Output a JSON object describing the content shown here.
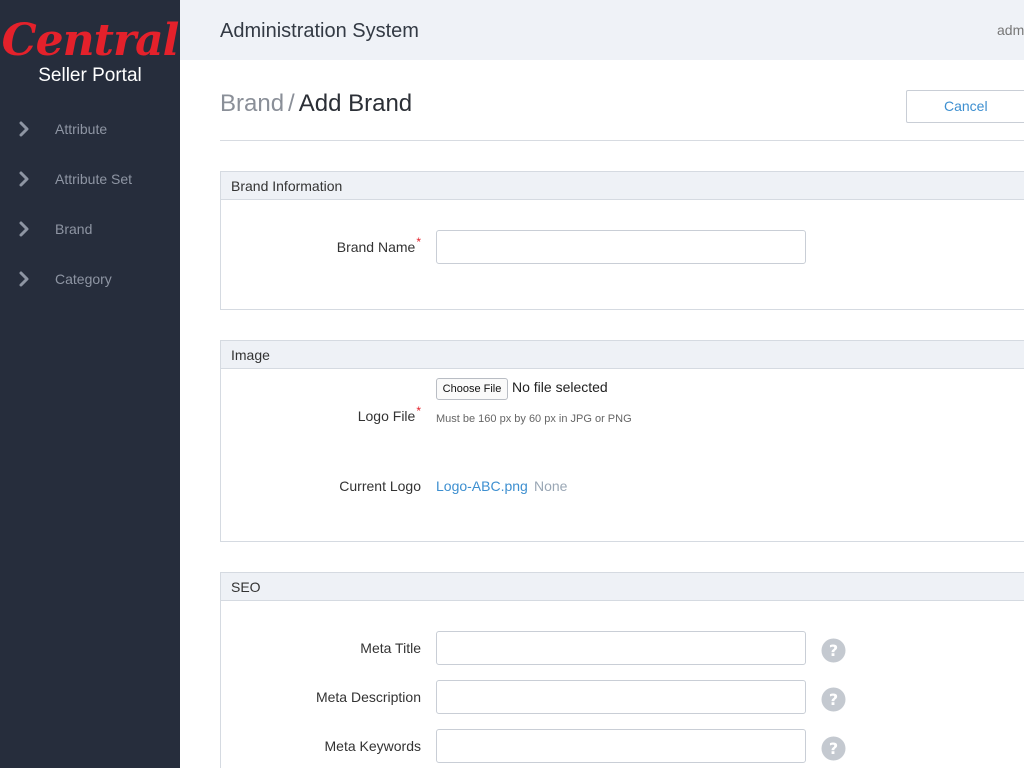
{
  "sidebar": {
    "logo_script": "Central",
    "logo_sub": "Seller Portal",
    "items": [
      {
        "label": "Attribute",
        "icon": "chevron-right-icon"
      },
      {
        "label": "Attribute Set",
        "icon": "chevron-right-icon"
      },
      {
        "label": "Brand",
        "icon": "chevron-right-icon"
      },
      {
        "label": "Category",
        "icon": "chevron-right-icon"
      }
    ]
  },
  "header": {
    "title": "Administration System",
    "user": "adm"
  },
  "page": {
    "breadcrumb_parent": "Brand",
    "breadcrumb_sep": "/",
    "breadcrumb_current": "Add Brand",
    "cancel_label": "Cancel"
  },
  "brand_info": {
    "title": "Brand Information",
    "brand_name_label": "Brand Name",
    "required_mark": "*",
    "brand_name_value": ""
  },
  "image": {
    "title": "Image",
    "logo_file_label": "Logo File",
    "required_mark": "*",
    "choose_file_label": "Choose File",
    "file_status": "No file selected",
    "hint": "Must be 160 px by 60 px in JPG or PNG",
    "current_logo_label": "Current Logo",
    "current_logo_link": "Logo-ABC.png",
    "current_logo_none": "None"
  },
  "seo": {
    "title": "SEO",
    "fields": [
      {
        "label": "Meta Title",
        "value": "",
        "help_icon": "question-circle-icon"
      },
      {
        "label": "Meta Description",
        "value": "",
        "help_icon": "question-circle-icon"
      },
      {
        "label": "Meta Keywords",
        "value": "",
        "help_icon": "question-circle-icon"
      }
    ]
  },
  "colors": {
    "sidebar_bg": "#262d3c",
    "header_bg": "#eff2f7",
    "accent": "#3d8fd0",
    "brand_red": "#e4212b"
  }
}
